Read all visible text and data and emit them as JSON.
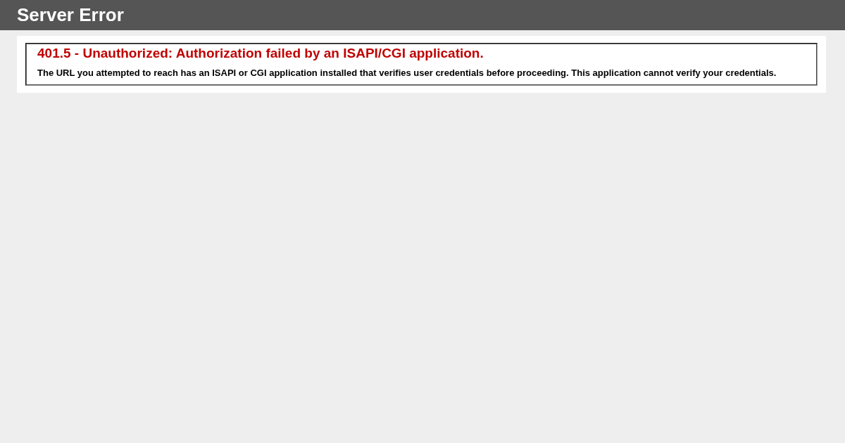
{
  "header": {
    "title": "Server Error"
  },
  "error": {
    "heading": "401.5 - Unauthorized: Authorization failed by an ISAPI/CGI application.",
    "message": "The URL you attempted to reach has an ISAPI or CGI application installed that verifies user credentials before proceeding. This application cannot verify your credentials."
  }
}
